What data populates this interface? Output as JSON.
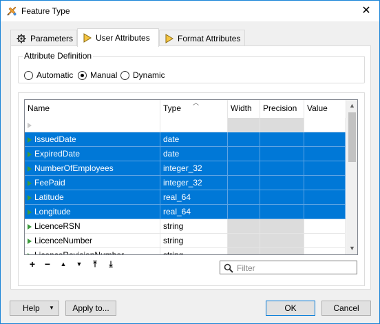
{
  "window": {
    "title": "Feature Type",
    "close_glyph": "✕"
  },
  "tabs": [
    {
      "label": "Parameters",
      "icon": "gear-icon",
      "active": false
    },
    {
      "label": "User Attributes",
      "icon": "pointer-arrow-icon",
      "active": true
    },
    {
      "label": "Format Attributes",
      "icon": "pointer-arrow-icon",
      "active": false
    }
  ],
  "attribute_definition": {
    "label": "Attribute Definition",
    "options": [
      "Automatic",
      "Manual",
      "Dynamic"
    ],
    "selected": "Manual"
  },
  "grid": {
    "columns": [
      "Name",
      "Type",
      "Width",
      "Precision",
      "Value"
    ],
    "rows": [
      {
        "name": "IssuedDate",
        "type": "date",
        "selected": true
      },
      {
        "name": "ExpiredDate",
        "type": "date",
        "selected": true
      },
      {
        "name": "NumberOfEmployees",
        "type": "integer_32",
        "selected": true
      },
      {
        "name": "FeePaid",
        "type": "integer_32",
        "selected": true
      },
      {
        "name": "Latitude",
        "type": "real_64",
        "selected": true
      },
      {
        "name": "Longitude",
        "type": "real_64",
        "selected": true
      },
      {
        "name": "LicenceRSN",
        "type": "string",
        "selected": false
      },
      {
        "name": "LicenceNumber",
        "type": "string",
        "selected": false
      },
      {
        "name": "LicenceRevisionNumber",
        "type": "string",
        "selected": false
      }
    ]
  },
  "toolbar": {
    "add": "+",
    "remove": "−",
    "move_up": "▲",
    "move_down": "▼",
    "move_top": "⤒",
    "move_bottom": "⤓"
  },
  "filter": {
    "placeholder": "Filter",
    "value": ""
  },
  "buttons": {
    "help": "Help",
    "help_arrow": "▼",
    "apply_to": "Apply to...",
    "ok": "OK",
    "cancel": "Cancel"
  },
  "colors": {
    "selection": "#0078d7",
    "accent_border": "#1883d7",
    "row_marker": "#3b9a3b"
  }
}
